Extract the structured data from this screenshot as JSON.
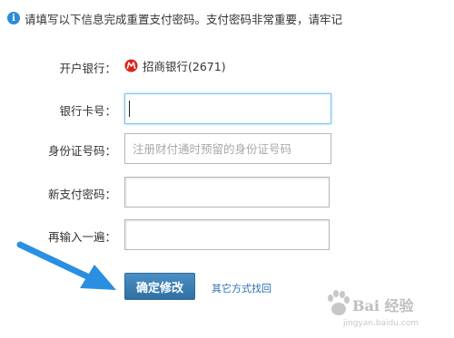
{
  "notice": {
    "icon": "info-icon",
    "text": "请填写以下信息完成重置支付密码。支付密码非常重要，请牢记"
  },
  "form": {
    "bank": {
      "label": "开户银行：",
      "logo": "cmb-bank-logo",
      "value": "招商银行(2671)"
    },
    "card_number": {
      "label": "银行卡号：",
      "value": "",
      "placeholder": ""
    },
    "id_number": {
      "label": "身份证号码：",
      "value": "",
      "placeholder": "注册财付通时预留的身份证号码"
    },
    "new_password": {
      "label": "新支付密码：",
      "value": ""
    },
    "confirm_password": {
      "label": "再输入一遍：",
      "value": ""
    }
  },
  "actions": {
    "confirm_label": "确定修改",
    "other_method_label": "其它方式找回"
  },
  "watermark": {
    "main": "Bai 经验",
    "sub": "jingyan.baidu.com"
  },
  "colors": {
    "accent": "#2f6fa3",
    "link": "#2b6fb5",
    "arrow": "#2a8fe0",
    "bank_logo": "#d9261c"
  }
}
